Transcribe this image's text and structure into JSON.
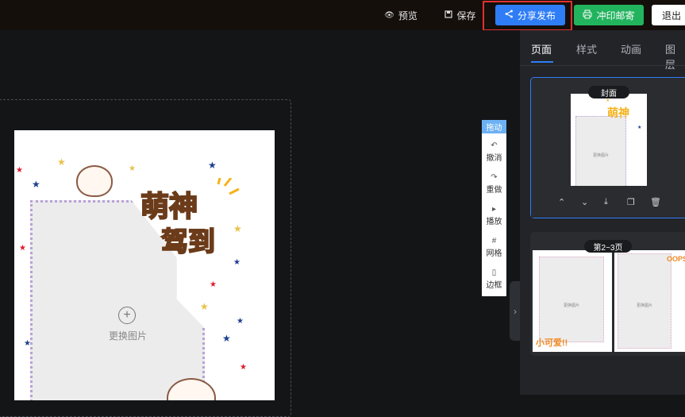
{
  "topbar": {
    "preview_label": "预览",
    "save_label": "保存",
    "share_label": "分享发布",
    "print_label": "冲印邮寄",
    "exit_label": "退出"
  },
  "canvas": {
    "replace_image_label": "更换图片",
    "title_line1": "萌神",
    "title_line2": "驾到"
  },
  "toolbar": {
    "drag_label": "拖动",
    "undo_label": "撤消",
    "redo_label": "重做",
    "play_label": "播放",
    "grid_label": "网格",
    "border_label": "边框"
  },
  "panel": {
    "tabs": [
      {
        "label": "页面"
      },
      {
        "label": "样式"
      },
      {
        "label": "动画"
      },
      {
        "label": "图层"
      }
    ],
    "cards": [
      {
        "label": "封面",
        "replace_label": "更换图片"
      },
      {
        "label": "第2~3页",
        "replace_label": "更换图片"
      }
    ],
    "thumb2_text_left": "小可爱!!",
    "thumb2_text_right": "OOPS"
  },
  "colors": {
    "primary": "#2f7df6",
    "print_green": "#22b35e",
    "highlight_red": "#e03131",
    "toolbar_drag": "#6cb1f3"
  }
}
